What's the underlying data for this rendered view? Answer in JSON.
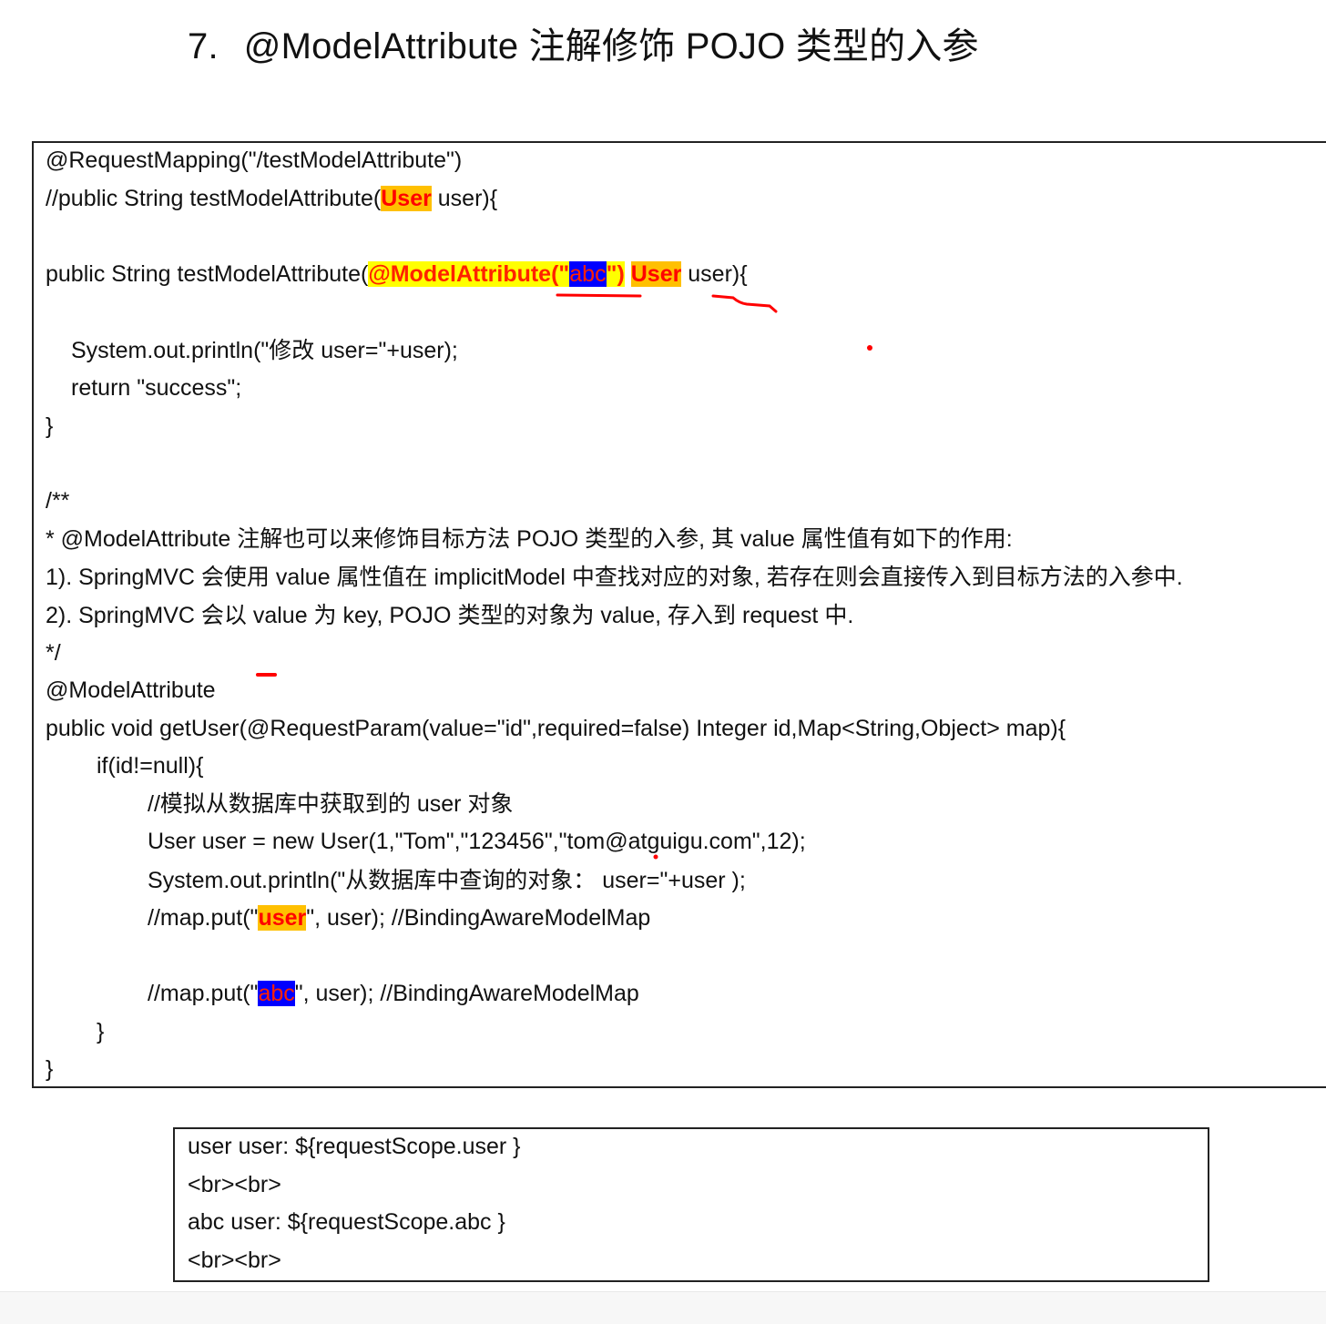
{
  "title": {
    "number": "7.",
    "text": "@ModelAttribute 注解修饰 POJO 类型的入参"
  },
  "code": {
    "l1": "@RequestMapping(\"/testModelAttribute\")",
    "l2_pre": "//public String testModelAttribute(",
    "l2_hl": "User",
    "l2_post": " user){",
    "l3_pre": "public String testModelAttribute(",
    "l3_hl1": "@ModelAttribute(\"",
    "l3_hl2": "abc",
    "l3_hl3": "\")",
    "l3_sp": " ",
    "l3_hl4": "User",
    "l3_post": " user){",
    "l4": "System.out.println(\"修改 user=\"+user);",
    "l5": "return \"success\";",
    "l6": "}",
    "l7": "/**",
    "l8": " * @ModelAttribute 注解也可以来修饰目标方法 POJO 类型的入参, 其 value 属性值有如下的作用:",
    "l9": "1). SpringMVC 会使用 value 属性值在 implicitModel 中查找对应的对象, 若存在则会直接传入到目标方法的入参中.",
    "l10": "2). SpringMVC 会以 value 为 key, POJO 类型的对象为 value, 存入到 request 中.",
    "l11": " */",
    "l12": "@ModelAttribute",
    "l13": "public void getUser(@RequestParam(value=\"id\",required=false) Integer id,Map<String,Object> map){",
    "l14": "if(id!=null){",
    "l15": "//模拟从数据库中获取到的 user 对象",
    "l16": "User user = new User(1,\"Tom\",\"123456\",\"tom@atguigu.com\",12);",
    "l17": "System.out.println(\"从数据库中查询的对象： user=\"+user );",
    "l18_pre": "//map.put(\"",
    "l18_hl": "user",
    "l18_post": "\", user); //BindingAwareModelMap",
    "l19_pre": "//map.put(\"",
    "l19_hl": "abc",
    "l19_post": "\", user); //BindingAwareModelMap",
    "l20": "}",
    "l21": "}"
  },
  "result": {
    "r1": "user user: ${requestScope.user }",
    "r2": "<br><br>",
    "r3": "abc user: ${requestScope.abc }",
    "r4": "<br><br>"
  },
  "colors": {
    "highlight_yellow": "#ffff00",
    "highlight_orange": "#ffc000",
    "highlight_blue": "#0000ff",
    "highlight_text": "#ff0000",
    "pen_red": "#ff0000"
  }
}
